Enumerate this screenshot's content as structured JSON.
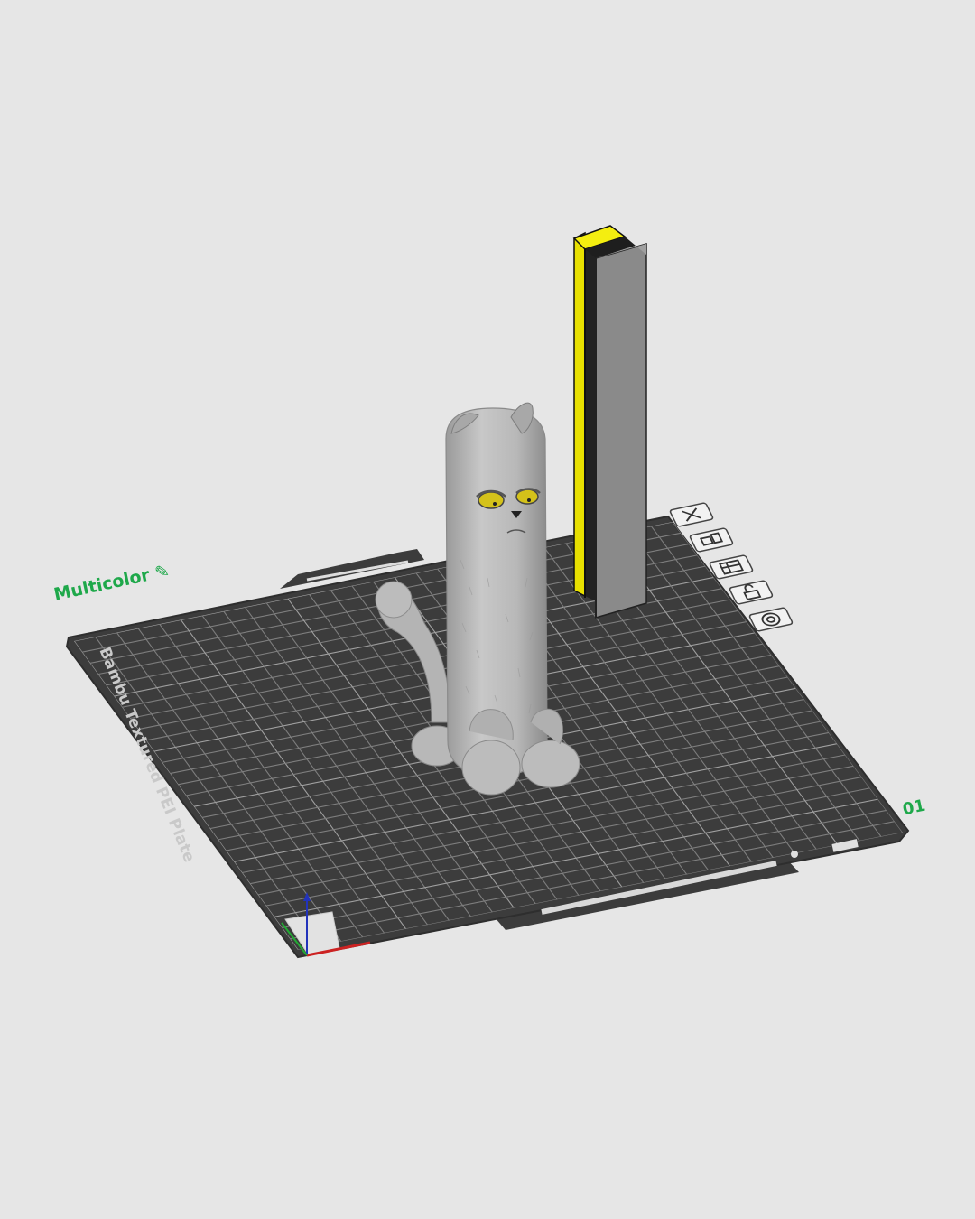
{
  "plate": {
    "name": "Multicolor",
    "name_edit_icon": "pencil-icon",
    "number": "01",
    "brand_text": "Bambu Textured PEI Plate",
    "surface_color": "#3c3c3c",
    "grid_color": "#7a7a7a"
  },
  "plate_toolbar": [
    {
      "name": "close-plate-button",
      "icon": "close-icon"
    },
    {
      "name": "arrange-button",
      "icon": "arrange-icon"
    },
    {
      "name": "plate-settings-button",
      "icon": "settings-panel-icon"
    },
    {
      "name": "lock-plate-button",
      "icon": "lock-icon"
    },
    {
      "name": "orient-button",
      "icon": "gear-icon"
    }
  ],
  "objects": {
    "model": {
      "name": "cat-model",
      "color": "#bdbdbd",
      "eye_color": "#d4c21a"
    },
    "prime_tower": {
      "name": "prime-tower",
      "colors": [
        "#e8e000",
        "#222222",
        "#8a8a8a"
      ]
    }
  },
  "axes": {
    "x_color": "#cc2222",
    "y_color": "#22aa33",
    "z_color": "#2233bb"
  }
}
